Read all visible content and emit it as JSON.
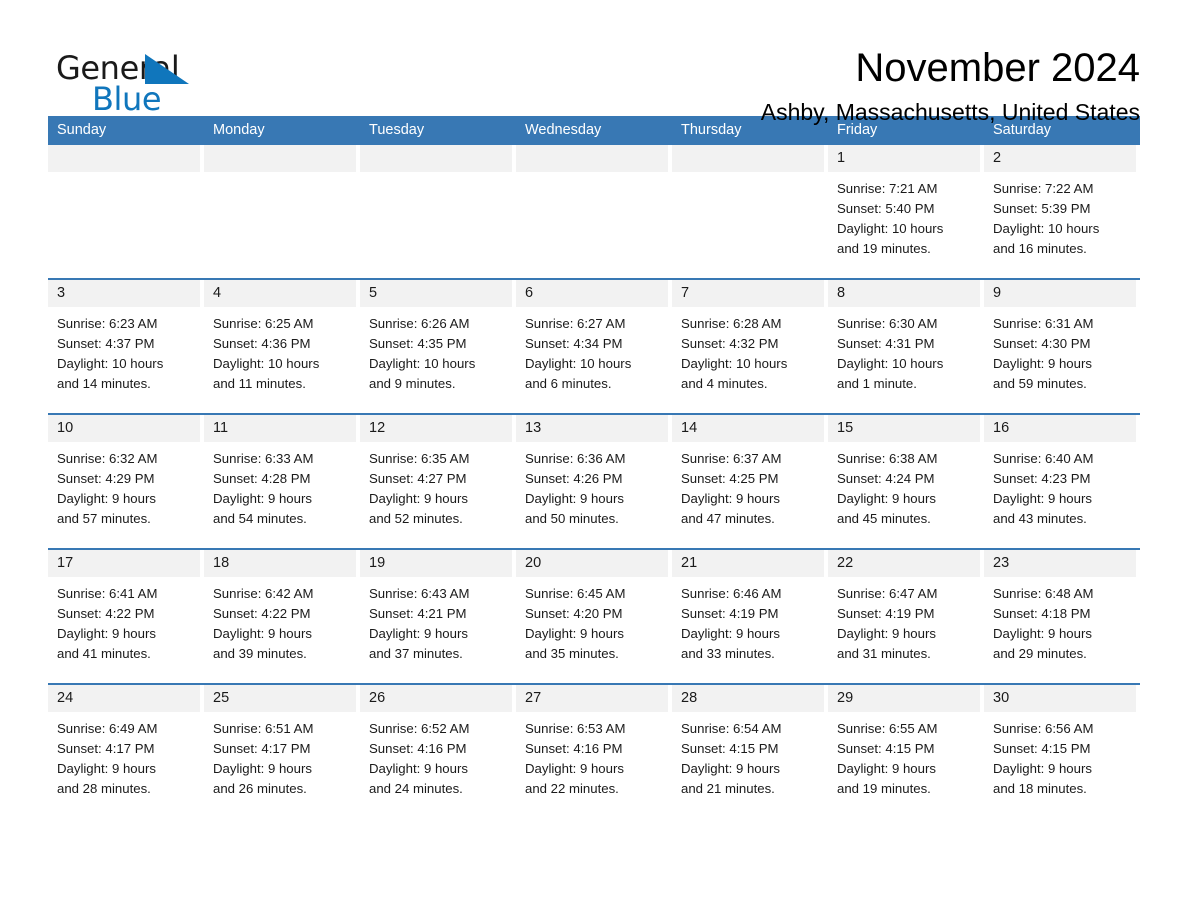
{
  "brand": {
    "name_top": "General",
    "name_bottom": "Blue",
    "accent_color": "#1076bc"
  },
  "header": {
    "month_title": "November 2024",
    "location": "Ashby, Massachusetts, United States",
    "header_blue": "#3878b4",
    "date_band_gray": "#f2f2f2"
  },
  "calendar": {
    "weekdays": [
      "Sunday",
      "Monday",
      "Tuesday",
      "Wednesday",
      "Thursday",
      "Friday",
      "Saturday"
    ],
    "weeks": [
      [
        {
          "date": "",
          "empty": true
        },
        {
          "date": "",
          "empty": true
        },
        {
          "date": "",
          "empty": true
        },
        {
          "date": "",
          "empty": true
        },
        {
          "date": "",
          "empty": true
        },
        {
          "date": "1",
          "sunrise": "Sunrise: 7:21 AM",
          "sunset": "Sunset: 5:40 PM",
          "daylight_1": "Daylight: 10 hours",
          "daylight_2": "and 19 minutes."
        },
        {
          "date": "2",
          "sunrise": "Sunrise: 7:22 AM",
          "sunset": "Sunset: 5:39 PM",
          "daylight_1": "Daylight: 10 hours",
          "daylight_2": "and 16 minutes."
        }
      ],
      [
        {
          "date": "3",
          "sunrise": "Sunrise: 6:23 AM",
          "sunset": "Sunset: 4:37 PM",
          "daylight_1": "Daylight: 10 hours",
          "daylight_2": "and 14 minutes."
        },
        {
          "date": "4",
          "sunrise": "Sunrise: 6:25 AM",
          "sunset": "Sunset: 4:36 PM",
          "daylight_1": "Daylight: 10 hours",
          "daylight_2": "and 11 minutes."
        },
        {
          "date": "5",
          "sunrise": "Sunrise: 6:26 AM",
          "sunset": "Sunset: 4:35 PM",
          "daylight_1": "Daylight: 10 hours",
          "daylight_2": "and 9 minutes."
        },
        {
          "date": "6",
          "sunrise": "Sunrise: 6:27 AM",
          "sunset": "Sunset: 4:34 PM",
          "daylight_1": "Daylight: 10 hours",
          "daylight_2": "and 6 minutes."
        },
        {
          "date": "7",
          "sunrise": "Sunrise: 6:28 AM",
          "sunset": "Sunset: 4:32 PM",
          "daylight_1": "Daylight: 10 hours",
          "daylight_2": "and 4 minutes."
        },
        {
          "date": "8",
          "sunrise": "Sunrise: 6:30 AM",
          "sunset": "Sunset: 4:31 PM",
          "daylight_1": "Daylight: 10 hours",
          "daylight_2": "and 1 minute."
        },
        {
          "date": "9",
          "sunrise": "Sunrise: 6:31 AM",
          "sunset": "Sunset: 4:30 PM",
          "daylight_1": "Daylight: 9 hours",
          "daylight_2": "and 59 minutes."
        }
      ],
      [
        {
          "date": "10",
          "sunrise": "Sunrise: 6:32 AM",
          "sunset": "Sunset: 4:29 PM",
          "daylight_1": "Daylight: 9 hours",
          "daylight_2": "and 57 minutes."
        },
        {
          "date": "11",
          "sunrise": "Sunrise: 6:33 AM",
          "sunset": "Sunset: 4:28 PM",
          "daylight_1": "Daylight: 9 hours",
          "daylight_2": "and 54 minutes."
        },
        {
          "date": "12",
          "sunrise": "Sunrise: 6:35 AM",
          "sunset": "Sunset: 4:27 PM",
          "daylight_1": "Daylight: 9 hours",
          "daylight_2": "and 52 minutes."
        },
        {
          "date": "13",
          "sunrise": "Sunrise: 6:36 AM",
          "sunset": "Sunset: 4:26 PM",
          "daylight_1": "Daylight: 9 hours",
          "daylight_2": "and 50 minutes."
        },
        {
          "date": "14",
          "sunrise": "Sunrise: 6:37 AM",
          "sunset": "Sunset: 4:25 PM",
          "daylight_1": "Daylight: 9 hours",
          "daylight_2": "and 47 minutes."
        },
        {
          "date": "15",
          "sunrise": "Sunrise: 6:38 AM",
          "sunset": "Sunset: 4:24 PM",
          "daylight_1": "Daylight: 9 hours",
          "daylight_2": "and 45 minutes."
        },
        {
          "date": "16",
          "sunrise": "Sunrise: 6:40 AM",
          "sunset": "Sunset: 4:23 PM",
          "daylight_1": "Daylight: 9 hours",
          "daylight_2": "and 43 minutes."
        }
      ],
      [
        {
          "date": "17",
          "sunrise": "Sunrise: 6:41 AM",
          "sunset": "Sunset: 4:22 PM",
          "daylight_1": "Daylight: 9 hours",
          "daylight_2": "and 41 minutes."
        },
        {
          "date": "18",
          "sunrise": "Sunrise: 6:42 AM",
          "sunset": "Sunset: 4:22 PM",
          "daylight_1": "Daylight: 9 hours",
          "daylight_2": "and 39 minutes."
        },
        {
          "date": "19",
          "sunrise": "Sunrise: 6:43 AM",
          "sunset": "Sunset: 4:21 PM",
          "daylight_1": "Daylight: 9 hours",
          "daylight_2": "and 37 minutes."
        },
        {
          "date": "20",
          "sunrise": "Sunrise: 6:45 AM",
          "sunset": "Sunset: 4:20 PM",
          "daylight_1": "Daylight: 9 hours",
          "daylight_2": "and 35 minutes."
        },
        {
          "date": "21",
          "sunrise": "Sunrise: 6:46 AM",
          "sunset": "Sunset: 4:19 PM",
          "daylight_1": "Daylight: 9 hours",
          "daylight_2": "and 33 minutes."
        },
        {
          "date": "22",
          "sunrise": "Sunrise: 6:47 AM",
          "sunset": "Sunset: 4:19 PM",
          "daylight_1": "Daylight: 9 hours",
          "daylight_2": "and 31 minutes."
        },
        {
          "date": "23",
          "sunrise": "Sunrise: 6:48 AM",
          "sunset": "Sunset: 4:18 PM",
          "daylight_1": "Daylight: 9 hours",
          "daylight_2": "and 29 minutes."
        }
      ],
      [
        {
          "date": "24",
          "sunrise": "Sunrise: 6:49 AM",
          "sunset": "Sunset: 4:17 PM",
          "daylight_1": "Daylight: 9 hours",
          "daylight_2": "and 28 minutes."
        },
        {
          "date": "25",
          "sunrise": "Sunrise: 6:51 AM",
          "sunset": "Sunset: 4:17 PM",
          "daylight_1": "Daylight: 9 hours",
          "daylight_2": "and 26 minutes."
        },
        {
          "date": "26",
          "sunrise": "Sunrise: 6:52 AM",
          "sunset": "Sunset: 4:16 PM",
          "daylight_1": "Daylight: 9 hours",
          "daylight_2": "and 24 minutes."
        },
        {
          "date": "27",
          "sunrise": "Sunrise: 6:53 AM",
          "sunset": "Sunset: 4:16 PM",
          "daylight_1": "Daylight: 9 hours",
          "daylight_2": "and 22 minutes."
        },
        {
          "date": "28",
          "sunrise": "Sunrise: 6:54 AM",
          "sunset": "Sunset: 4:15 PM",
          "daylight_1": "Daylight: 9 hours",
          "daylight_2": "and 21 minutes."
        },
        {
          "date": "29",
          "sunrise": "Sunrise: 6:55 AM",
          "sunset": "Sunset: 4:15 PM",
          "daylight_1": "Daylight: 9 hours",
          "daylight_2": "and 19 minutes."
        },
        {
          "date": "30",
          "sunrise": "Sunrise: 6:56 AM",
          "sunset": "Sunset: 4:15 PM",
          "daylight_1": "Daylight: 9 hours",
          "daylight_2": "and 18 minutes."
        }
      ]
    ]
  }
}
